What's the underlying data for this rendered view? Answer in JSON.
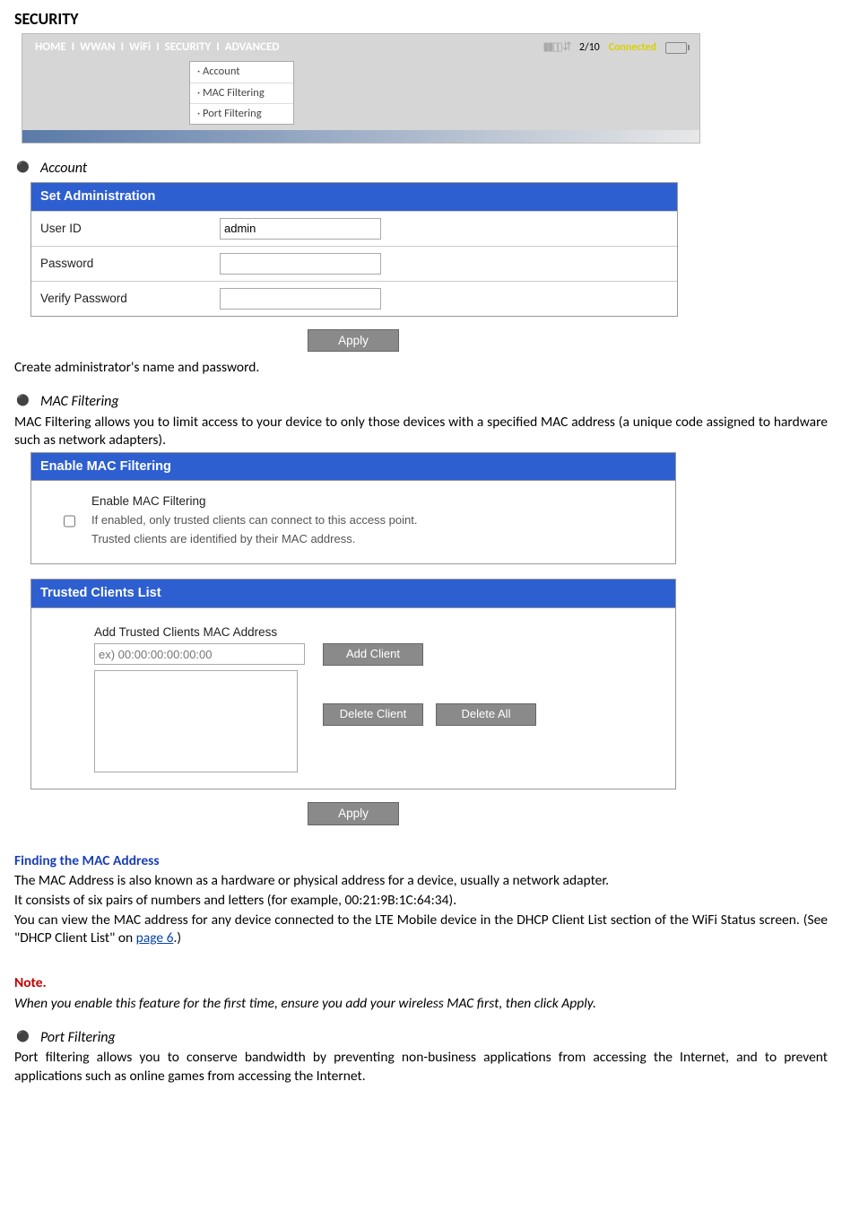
{
  "page_title": "SECURITY",
  "navbar": {
    "items": [
      "HOME",
      "WWAN",
      "WiFi",
      "SECURITY",
      "ADVANCED"
    ],
    "sep": "I",
    "count": "2/10",
    "status": "Connected",
    "dropdown": [
      "· Account",
      "· MAC Filtering",
      "· Port Filtering"
    ]
  },
  "sections": {
    "account": {
      "title": "Account",
      "panel_title": "Set Administration",
      "rows": {
        "user_id_label": "User ID",
        "user_id_value": "admin",
        "password_label": "Password",
        "verify_label": "Verify Password"
      },
      "apply": "Apply",
      "caption": "Create administrator's name and password."
    },
    "mac": {
      "title": "MAC Filtering",
      "intro": "MAC Filtering allows you to limit access to your device to only those devices with a specified MAC address (a unique code assigned to hardware such as network adapters).",
      "panel1_title": "Enable MAC Filtering",
      "enable_label": "Enable MAC Filtering",
      "enable_desc1": "If enabled, only trusted clients can connect to this access point.",
      "enable_desc2": "Trusted clients are identified by their MAC address.",
      "panel2_title": "Trusted Clients List",
      "add_label": "Add Trusted Clients MAC Address",
      "placeholder": "ex) 00:00:00:00:00:00",
      "add_btn": "Add Client",
      "del_btn": "Delete Client",
      "del_all_btn": "Delete All",
      "apply": "Apply"
    },
    "find": {
      "title": "Finding the MAC Address",
      "l1": "The MAC Address is also known as a hardware or physical address for a device, usually a network adapter.",
      "l2": "It consists of six pairs of numbers and letters (for example, 00:21:9B:1C:64:34).",
      "l3a": "You can view the MAC address for any device connected to the LTE Mobile device in the DHCP Client List section of the WiFi Status screen. (See \"DHCP Client List\" on ",
      "l3_link": "page 6",
      "l3b": ".)"
    },
    "note": {
      "title": "Note.",
      "body": "When you enable this feature for the first time, ensure you add your wireless MAC first, then click Apply."
    },
    "port": {
      "title": "Port Filtering",
      "body": "Port filtering allows you to conserve bandwidth by preventing non-business applications from accessing the Internet, and to prevent applications such as online games from accessing the Internet."
    }
  }
}
